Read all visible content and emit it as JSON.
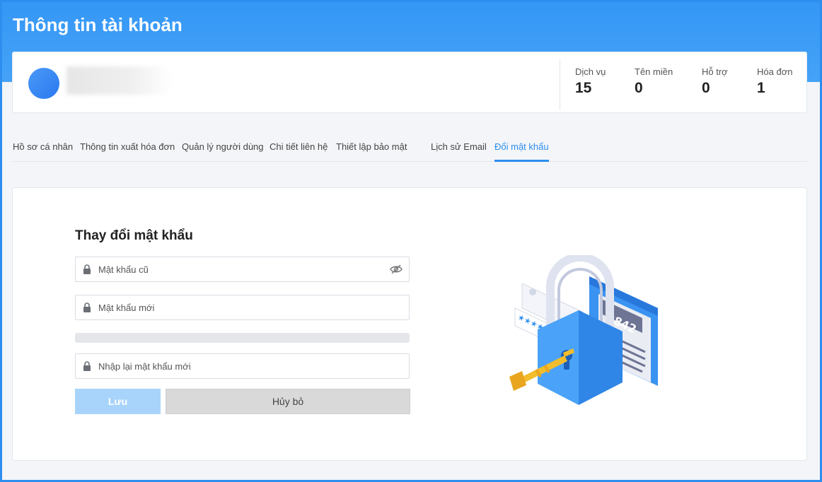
{
  "page": {
    "title": "Thông tin tài khoản"
  },
  "account": {
    "stats": [
      {
        "label": "Dịch vụ",
        "value": "15"
      },
      {
        "label": "Tên miền",
        "value": "0"
      },
      {
        "label": "Hỗ trợ",
        "value": "0"
      },
      {
        "label": "Hóa đơn",
        "value": "1"
      }
    ]
  },
  "tabs": [
    {
      "label": "Hồ sơ cá nhân",
      "active": false
    },
    {
      "label": "Thông tin xuất hóa đơn",
      "active": false
    },
    {
      "label": "Quản lý người dùng",
      "active": false
    },
    {
      "label": "Chi tiết liên hệ",
      "active": false
    },
    {
      "label": "Thiết lập bảo mật",
      "active": false
    },
    {
      "label": "Lịch sử Email",
      "active": false
    },
    {
      "label": "Đổi mật khẩu",
      "active": true
    }
  ],
  "form": {
    "title": "Thay đổi mật khẩu",
    "old_password": {
      "placeholder": "Mật khẩu cũ",
      "value": ""
    },
    "new_password": {
      "placeholder": "Mật khẩu mới",
      "value": ""
    },
    "confirm_password": {
      "placeholder": "Nhập lại mật khẩu mới",
      "value": ""
    },
    "save_label": "Lưu",
    "cancel_label": "Hủy bỏ"
  },
  "illustration": {
    "card_text": "$842"
  },
  "colors": {
    "accent": "#2d8ef0",
    "header": "#3497f5",
    "save_button": "#a8d4fb",
    "cancel_button": "#d9d9d9"
  },
  "icons": [
    "avatar",
    "lock-icon",
    "eye-slash-icon",
    "padlock-key-illustration"
  ]
}
